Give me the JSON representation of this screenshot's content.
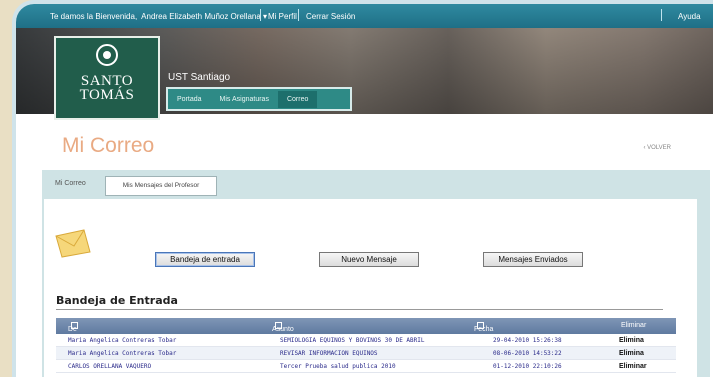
{
  "topbar": {
    "welcome": "Te damos la Bienvenida,",
    "user": "Andrea Elizabeth Muñoz Orellana",
    "profile": "Mi Perfil",
    "logout": "Cerrar Sesión",
    "help": "Ayuda"
  },
  "brand": {
    "line1": "SANTO",
    "line2": "TOMÁS",
    "campus": "UST Santiago"
  },
  "nav": [
    "Portada",
    "Mis Asignaturas",
    "Correo"
  ],
  "page": {
    "title": "Mi Correo",
    "back": "‹ VOLVER"
  },
  "tabs": [
    "Mi Correo",
    "Mis Mensajes del Profesor"
  ],
  "buttons": {
    "inbox": "Bandeja de entrada",
    "new": "Nuevo Mensaje",
    "sent": "Mensajes Enviados"
  },
  "inbox": {
    "heading": "Bandeja de Entrada",
    "columns": [
      "De",
      "Asunto",
      "Fecha",
      "Eliminar"
    ],
    "rows": [
      {
        "from": "Maria Angelica Contreras Tobar",
        "subject": "SEMIOLOGIA EQUINOS Y BOVINOS 30 DE ABRIL",
        "date": "29-04-2010 15:26:38",
        "action": "Elimina"
      },
      {
        "from": "Maria Angelica Contreras Tobar",
        "subject": "REVISAR INFORMACION EQUINOS",
        "date": "08-06-2010 14:53:22",
        "action": "Elimina"
      },
      {
        "from": "CARLOS ORELLANA VAQUERO",
        "subject": "Tercer Prueba salud publica 2010",
        "date": "01-12-2010 22:10:26",
        "action": "Eliminar"
      }
    ]
  },
  "colors": {
    "accent": "#2f8aa0",
    "brand": "#215d4b",
    "title": "#e9aa83"
  }
}
